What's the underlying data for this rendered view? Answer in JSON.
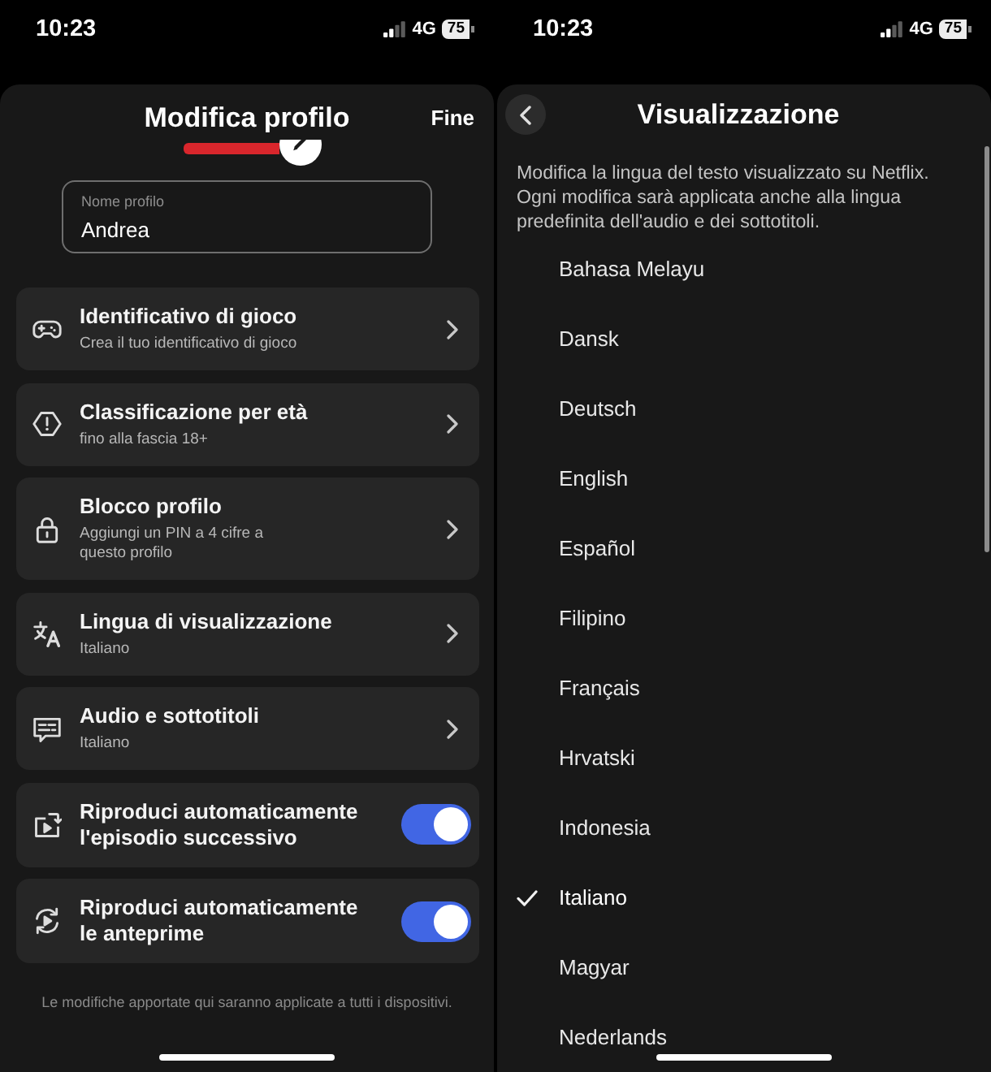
{
  "profile_screen": {
    "status_bar": {
      "time": "10:23",
      "network": "4G",
      "battery": "75"
    },
    "title": "Modifica profilo",
    "done_button": "Fine",
    "name_field": {
      "label": "Nome profilo",
      "value": "Andrea"
    },
    "settings": [
      {
        "kind": "link",
        "title": "Identificativo di gioco",
        "subtitle": "Crea il tuo identificativo di gioco"
      },
      {
        "kind": "link",
        "title": "Classificazione per età",
        "subtitle": "fino alla fascia 18+"
      },
      {
        "kind": "link",
        "title": "Blocco profilo",
        "subtitle": "Aggiungi un PIN a 4 cifre a\nquesto profilo"
      },
      {
        "kind": "link",
        "title": "Lingua di visualizzazione",
        "subtitle": "Italiano"
      },
      {
        "kind": "link",
        "title": "Audio e sottotitoli",
        "subtitle": "Italiano"
      },
      {
        "kind": "toggle",
        "title": "Riproduci automaticamente\nl'episodio successivo",
        "on": true
      },
      {
        "kind": "toggle",
        "title": "Riproduci automaticamente\nle anteprime",
        "on": true
      }
    ],
    "footer_note": "Le modifiche apportate qui saranno applicate a tutti i dispositivi."
  },
  "language_screen": {
    "status_bar": {
      "time": "10:23",
      "network": "4G",
      "battery": "75"
    },
    "title": "Visualizzazione",
    "description": "Modifica la lingua del testo visualizzato su Netflix. Ogni modifica sarà applicata anche alla lingua predefinita dell'audio e dei sottotitoli.",
    "languages": [
      {
        "name": "Bahasa Melayu",
        "selected": false
      },
      {
        "name": "Dansk",
        "selected": false
      },
      {
        "name": "Deutsch",
        "selected": false
      },
      {
        "name": "English",
        "selected": false
      },
      {
        "name": "Español",
        "selected": false
      },
      {
        "name": "Filipino",
        "selected": false
      },
      {
        "name": "Français",
        "selected": false
      },
      {
        "name": "Hrvatski",
        "selected": false
      },
      {
        "name": "Indonesia",
        "selected": false
      },
      {
        "name": "Italiano",
        "selected": true
      },
      {
        "name": "Magyar",
        "selected": false
      },
      {
        "name": "Nederlands",
        "selected": false
      }
    ]
  }
}
